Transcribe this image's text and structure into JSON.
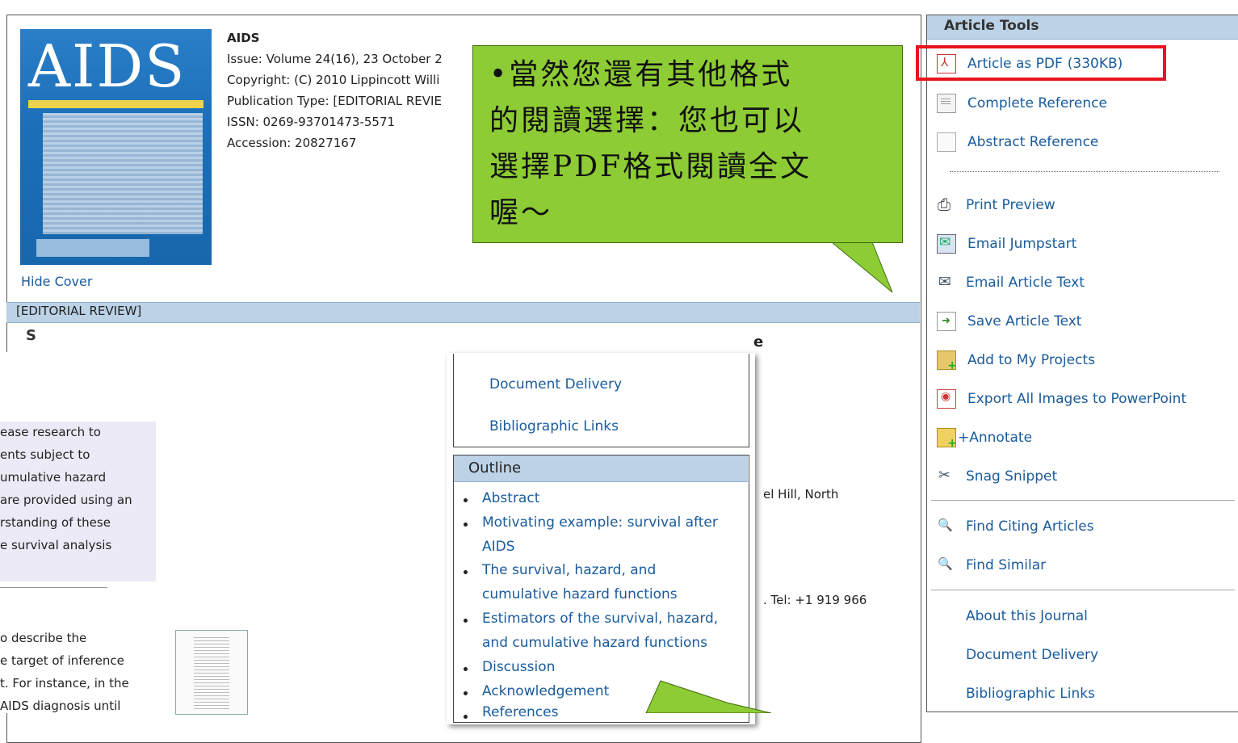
{
  "journal": {
    "cover_title": "AIDS",
    "name": "AIDS",
    "issue": "Issue: Volume 24(16), 23 October 2",
    "copyright": "Copyright: (C) 2010 Lippincott Willi",
    "publication_type": "Publication Type: [EDITORIAL REVIE",
    "issn": "ISSN: 0269-93701473-5571",
    "accession": "Accession: 20827167",
    "hide_cover": "Hide Cover"
  },
  "article": {
    "section_label": "[EDITORIAL REVIEW]",
    "title_fragment": "S",
    "abstract_lines": [
      "ease research to",
      "ents subject to",
      "umulative hazard",
      " are provided using an",
      "rstanding of these",
      "e survival analysis"
    ],
    "body_lines": [
      "o describe the",
      "e target of inference",
      "t. For instance, in the",
      "AIDS diagnosis until"
    ],
    "affiliation_fragment": "el Hill, North",
    "tel_fragment": ". Tel: +1 919 966",
    "title_end": "e"
  },
  "popup": {
    "links": [
      "Document Delivery",
      "Bibliographic Links"
    ],
    "outline_title": "Outline",
    "outline": [
      [
        "Abstract"
      ],
      [
        "Motivating example: survival after",
        "AIDS"
      ],
      [
        "The survival, hazard, and",
        "cumulative hazard functions"
      ],
      [
        "Estimators of the survival, hazard,",
        "and cumulative hazard functions"
      ],
      [
        "Discussion"
      ],
      [
        "Acknowledgement"
      ],
      [
        "References"
      ]
    ]
  },
  "sidebar": {
    "title": "Article Tools",
    "pdf_label": "Article as PDF",
    "pdf_size": "(330KB)",
    "complete_reference": "Complete Reference",
    "abstract_reference": "Abstract Reference",
    "print_preview": "Print Preview",
    "email_jumpstart": "Email Jumpstart",
    "email_article_text": "Email Article Text",
    "save_article_text": "Save Article Text",
    "add_to_projects": "Add to My Projects",
    "export_images": "Export All Images to PowerPoint",
    "annotate": "+Annotate",
    "snag_snippet": "Snag Snippet",
    "find_citing": "Find Citing Articles",
    "find_similar": "Find Similar",
    "about_journal": "About this Journal",
    "document_delivery": "Document Delivery",
    "bibliographic_links": "Bibliographic Links"
  },
  "callout": {
    "lines": [
      "•當然您還有其他格式",
      "的閱讀選擇：您也可以",
      "選擇PDF格式閱讀全文",
      "喔～"
    ]
  },
  "colors": {
    "link": "#1a5b9c",
    "header_band": "#bcd2e6",
    "callout_green": "#8dcc34",
    "highlight_red": "#e8131b"
  }
}
